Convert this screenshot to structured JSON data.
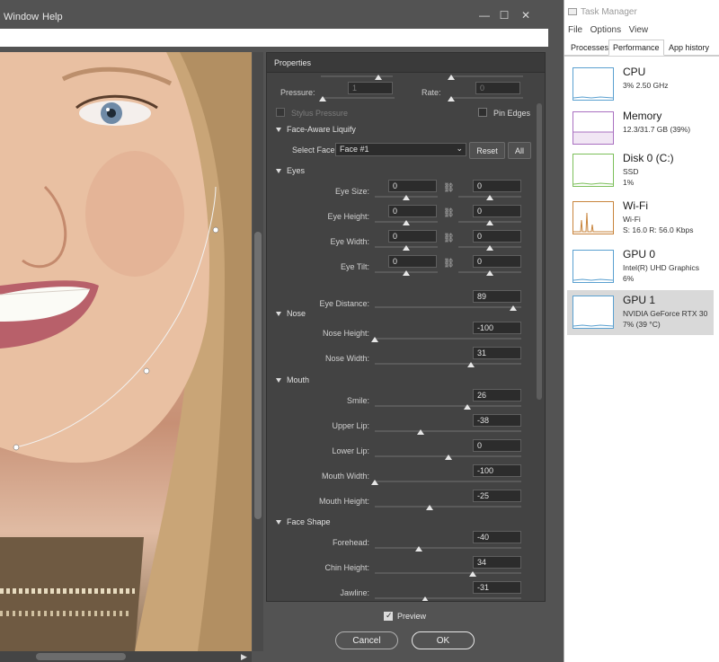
{
  "menubar": {
    "window": "Window",
    "help": "Help",
    "minimize": "—",
    "maximize": "☐",
    "close": "✕"
  },
  "panel": {
    "title": "Properties",
    "pressure_label": "Pressure:",
    "pressure_value": "1",
    "rate_label": "Rate:",
    "rate_value": "0",
    "stylus_label": "Stylus Pressure",
    "pin_edges_label": "Pin Edges",
    "face_aware_label": "Face-Aware Liquify",
    "select_face_label": "Select Face:",
    "select_face_value": "Face #1",
    "reset_label": "Reset",
    "all_label": "All",
    "eyes": {
      "title": "Eyes",
      "rows": [
        {
          "label": "Eye Size:",
          "left": "0",
          "left_pos": 0.5,
          "right": "0",
          "right_pos": 0.5
        },
        {
          "label": "Eye Height:",
          "left": "0",
          "left_pos": 0.5,
          "right": "0",
          "right_pos": 0.5
        },
        {
          "label": "Eye Width:",
          "left": "0",
          "left_pos": 0.5,
          "right": "0",
          "right_pos": 0.5
        },
        {
          "label": "Eye Tilt:",
          "left": "0",
          "left_pos": 0.5,
          "right": "0",
          "right_pos": 0.5
        }
      ],
      "distance_label": "Eye Distance:",
      "distance_value": "89",
      "distance_pos": 0.945
    },
    "nose": {
      "title": "Nose",
      "rows": [
        {
          "label": "Nose Height:",
          "value": "-100",
          "pos": 0.0
        },
        {
          "label": "Nose Width:",
          "value": "31",
          "pos": 0.655
        }
      ]
    },
    "mouth": {
      "title": "Mouth",
      "rows": [
        {
          "label": "Smile:",
          "value": "26",
          "pos": 0.63
        },
        {
          "label": "Upper Lip:",
          "value": "-38",
          "pos": 0.31
        },
        {
          "label": "Lower Lip:",
          "value": "0",
          "pos": 0.5
        },
        {
          "label": "Mouth Width:",
          "value": "-100",
          "pos": 0.0
        },
        {
          "label": "Mouth Height:",
          "value": "-25",
          "pos": 0.375
        }
      ]
    },
    "face_shape": {
      "title": "Face Shape",
      "rows": [
        {
          "label": "Forehead:",
          "value": "-40",
          "pos": 0.3
        },
        {
          "label": "Chin Height:",
          "value": "34",
          "pos": 0.67
        },
        {
          "label": "Jawline:",
          "value": "-31",
          "pos": 0.345
        }
      ]
    },
    "preview_label": "Preview",
    "cancel_label": "Cancel",
    "ok_label": "OK"
  },
  "task_manager": {
    "title": "Task Manager",
    "menu": [
      "File",
      "Options",
      "View"
    ],
    "tabs": [
      "Processes",
      "Performance",
      "App history"
    ],
    "active_tab": "Performance",
    "items": [
      {
        "name": "CPU",
        "line1": "3%  2.50 GHz",
        "line2": "",
        "color": "#5aa0d0"
      },
      {
        "name": "Memory",
        "line1": "12.3/31.7 GB (39%)",
        "line2": "",
        "color": "#a970c0"
      },
      {
        "name": "Disk 0 (C:)",
        "line1": "SSD",
        "line2": "1%",
        "color": "#7cbf5a"
      },
      {
        "name": "Wi-Fi",
        "line1": "Wi-Fi",
        "line2": "S: 16.0  R: 56.0 Kbps",
        "color": "#c8843c"
      },
      {
        "name": "GPU 0",
        "line1": "Intel(R) UHD Graphics",
        "line2": "6%",
        "color": "#5aa0d0"
      },
      {
        "name": "GPU 1",
        "line1": "NVIDIA GeForce RTX 30",
        "line2": "7%  (39 °C)",
        "color": "#5aa0d0"
      }
    ]
  }
}
